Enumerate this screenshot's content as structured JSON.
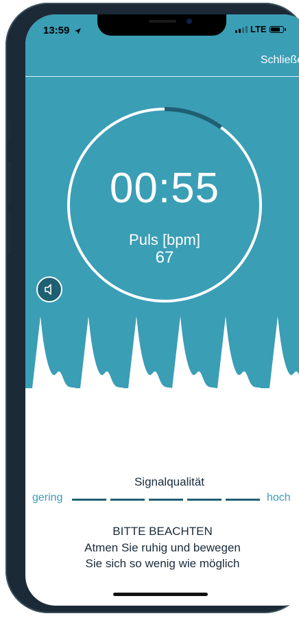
{
  "status_bar": {
    "time": "13:59",
    "network": "LTE"
  },
  "header": {
    "close_label": "Schließen"
  },
  "measurement": {
    "timer": "00:55",
    "pulse_label": "Puls [bpm]",
    "pulse_value": "67",
    "ring_progress": 0.1
  },
  "signal_quality": {
    "title": "Signalqualität",
    "low_label": "gering",
    "high_label": "hoch",
    "segment_count": 5
  },
  "notice": {
    "title": "BITTE BEACHTEN",
    "line1": "Atmen Sie ruhig und bewegen",
    "line2": "Sie sich so wenig wie möglich"
  },
  "colors": {
    "teal": "#3a9eb5",
    "dark_teal": "#1f5f72",
    "text_dark": "#1a2a3a"
  },
  "icons": {
    "location": "location-arrow-icon",
    "sound": "speaker-icon"
  }
}
